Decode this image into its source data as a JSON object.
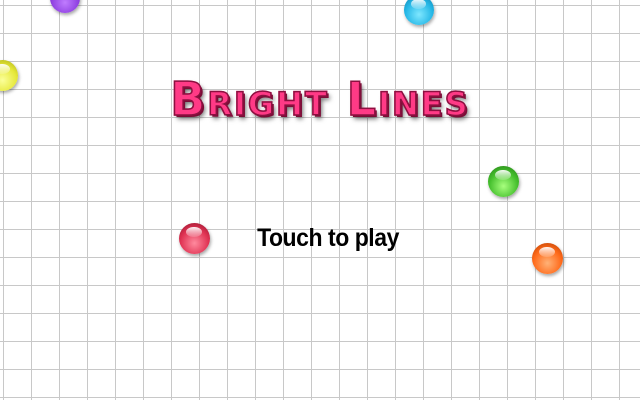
{
  "game": {
    "title": "Bright Lines",
    "prompt": "Touch to play"
  },
  "colors": {
    "background": "#ffffff",
    "grid_line": "#c8c8c8",
    "title_fill": "#ff3a86",
    "title_outline": "#8c1040",
    "prompt_text": "#000000"
  },
  "balls": [
    {
      "name": "purple-ball",
      "color": "#8e3fe0"
    },
    {
      "name": "cyan-ball",
      "color": "#25b7e6"
    },
    {
      "name": "yellow-ball",
      "color": "#e6e83a"
    },
    {
      "name": "green-ball",
      "color": "#46c02e"
    },
    {
      "name": "red-ball",
      "color": "#e03353"
    },
    {
      "name": "orange-ball",
      "color": "#ff6a1a"
    }
  ]
}
